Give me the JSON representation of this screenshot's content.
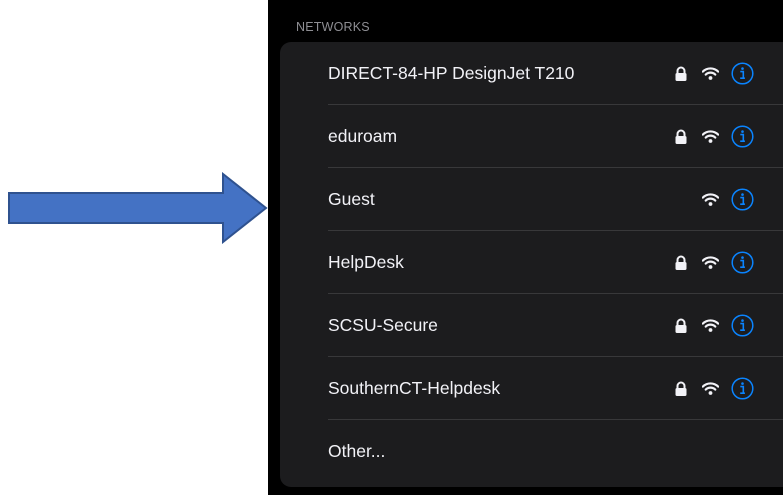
{
  "section_header": "NETWORKS",
  "networks": [
    {
      "name": "DIRECT-84-HP DesignJet T210",
      "secured": true
    },
    {
      "name": "eduroam",
      "secured": true
    },
    {
      "name": "Guest",
      "secured": false
    },
    {
      "name": "HelpDesk",
      "secured": true
    },
    {
      "name": "SCSU-Secure",
      "secured": true
    },
    {
      "name": "SouthernCT-Helpdesk",
      "secured": true
    }
  ],
  "other_label": "Other...",
  "colors": {
    "accent": "#0a84ff",
    "arrow_fill": "#4472c4",
    "arrow_stroke": "#2f528f",
    "background": "#000000",
    "list_background": "#1c1c1e"
  },
  "icons": {
    "lock": "lock-icon",
    "wifi": "wifi-icon",
    "info": "info-icon",
    "arrow": "right-arrow-icon"
  }
}
